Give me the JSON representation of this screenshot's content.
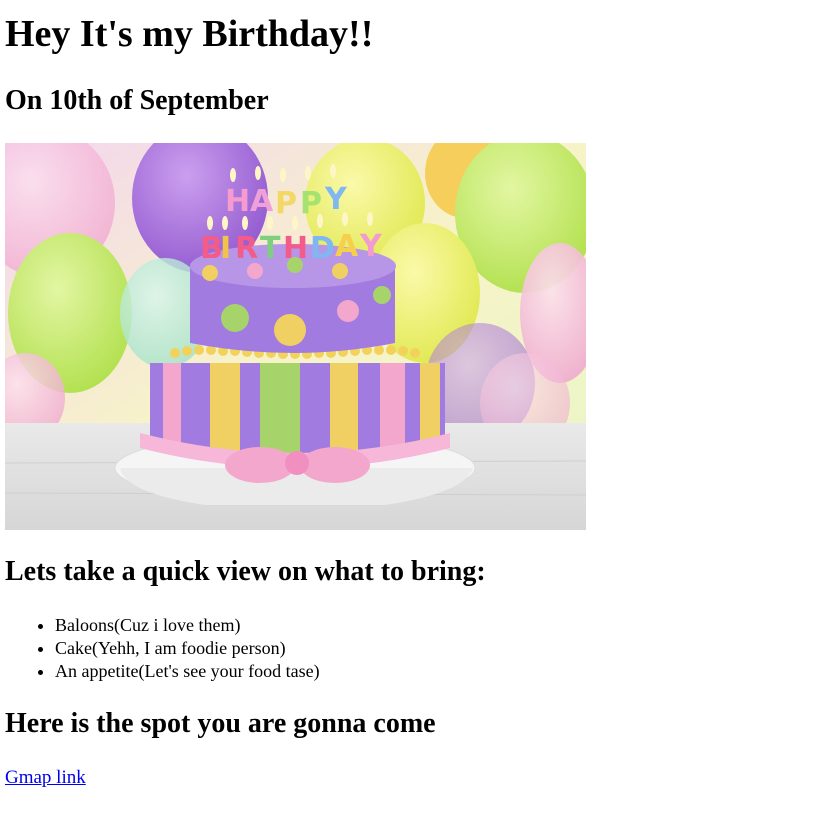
{
  "page": {
    "title": "Hey It's my Birthday!!",
    "date_heading": "On 10th of September"
  },
  "hero_image": {
    "alt": "Happy Birthday cake",
    "candle_letters": "HAPPY BIRTHDAY",
    "colors": {
      "balloon_purple": "#9b5fd6",
      "balloon_yellow": "#e6ef4a",
      "balloon_green": "#bde84a",
      "balloon_pink": "#f5a6d0",
      "cake_purple": "#a27be0",
      "cake_pink": "#f4a7cc",
      "cake_yellow": "#f0d062",
      "cake_green": "#a6d46a",
      "plate": "#f3f3f3"
    }
  },
  "bring_section": {
    "heading": "Lets take a quick view on what to bring:",
    "items": [
      "Baloons(Cuz i love them)",
      "Cake(Yehh, I am foodie person)",
      "An appetite(Let's see your food tase)"
    ]
  },
  "spot_section": {
    "heading": "Here is the spot you are gonna come",
    "link_label": "Gmap link"
  }
}
